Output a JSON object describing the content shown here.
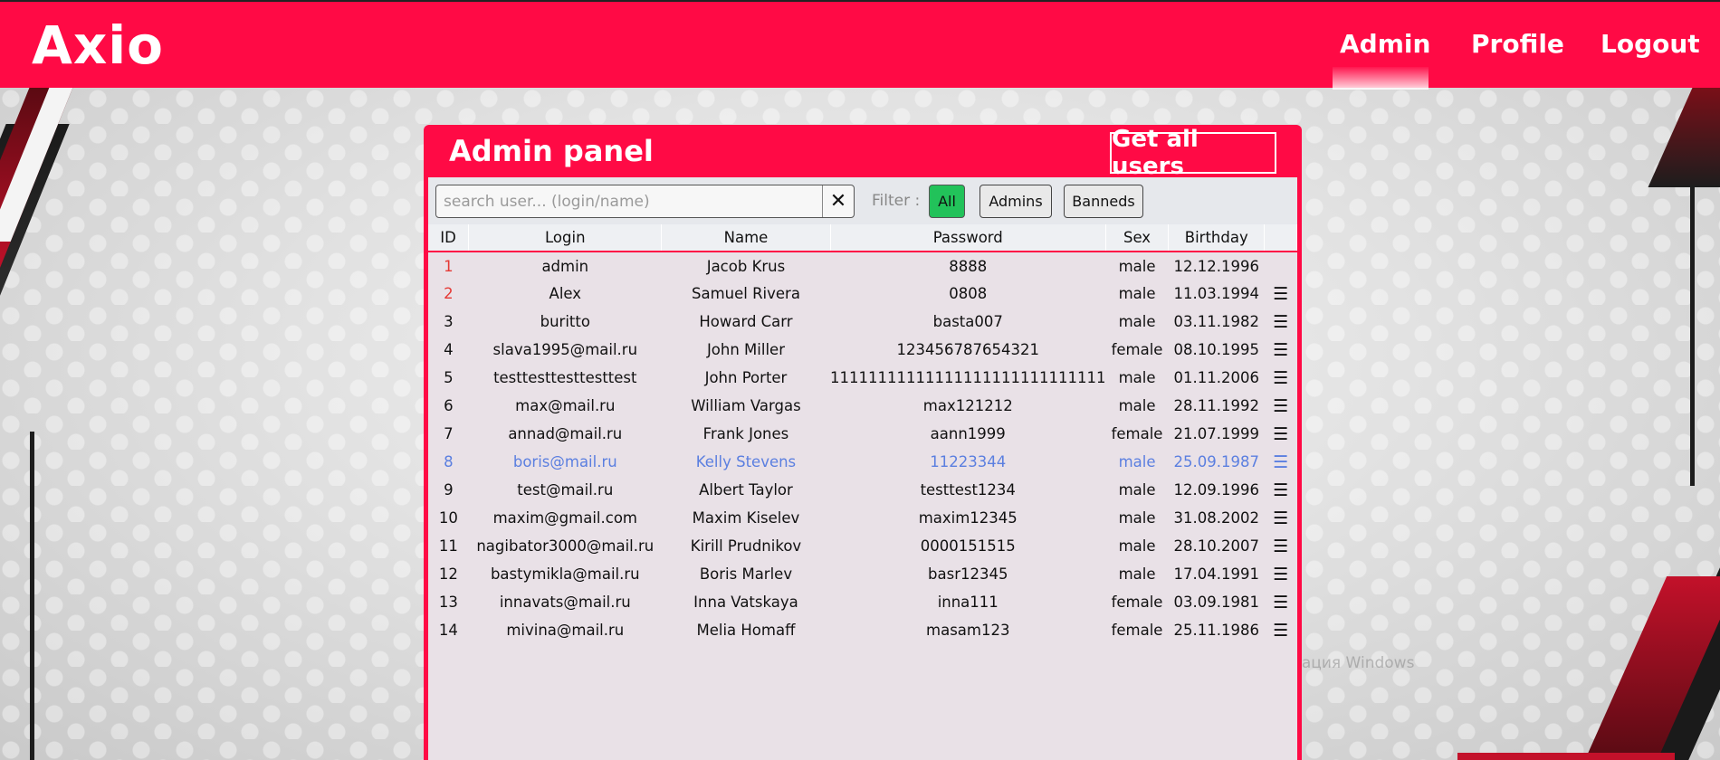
{
  "header": {
    "logo": "Axio",
    "nav": [
      {
        "label": "Admin",
        "active": true
      },
      {
        "label": "Profile",
        "active": false
      },
      {
        "label": "Logout",
        "active": false
      }
    ]
  },
  "panel": {
    "title": "Admin panel",
    "get_all_button": "Get all users",
    "search": {
      "placeholder": "search user... (login/name)",
      "value": "",
      "clear_icon": "✕"
    },
    "filter": {
      "label": "Filter :",
      "options": [
        "All",
        "Admins",
        "Banneds"
      ],
      "selected": "All"
    },
    "table": {
      "columns": [
        "ID",
        "Login",
        "Name",
        "Password",
        "Sex",
        "Birthday",
        ""
      ],
      "rows": [
        {
          "id": "1",
          "login": "admin",
          "name": "Jacob Krus",
          "password": "8888",
          "sex": "male",
          "birthday": "12.12.1996",
          "menu": ""
        },
        {
          "id": "2",
          "login": "Alex",
          "name": "Samuel Rivera",
          "password": "0808",
          "sex": "male",
          "birthday": "11.03.1994",
          "menu": "☰"
        },
        {
          "id": "3",
          "login": "buritto",
          "name": "Howard Carr",
          "password": "basta007",
          "sex": "male",
          "birthday": "03.11.1982",
          "menu": "☰"
        },
        {
          "id": "4",
          "login": "slava1995@mail.ru",
          "name": "John Miller",
          "password": "123456787654321",
          "sex": "female",
          "birthday": "08.10.1995",
          "menu": "☰"
        },
        {
          "id": "5",
          "login": "testtesttesttesttest",
          "name": "John Porter",
          "password": "11111111111111111111111111111",
          "sex": "male",
          "birthday": "01.11.2006",
          "menu": "☰"
        },
        {
          "id": "6",
          "login": "max@mail.ru",
          "name": "William Vargas",
          "password": "max121212",
          "sex": "male",
          "birthday": "28.11.1992",
          "menu": "☰"
        },
        {
          "id": "7",
          "login": "annad@mail.ru",
          "name": "Frank Jones",
          "password": "aann1999",
          "sex": "female",
          "birthday": "21.07.1999",
          "menu": "☰"
        },
        {
          "id": "8",
          "login": "boris@mail.ru",
          "name": "Kelly Stevens",
          "password": "11223344",
          "sex": "male",
          "birthday": "25.09.1987",
          "menu": "☰"
        },
        {
          "id": "9",
          "login": "test@mail.ru",
          "name": "Albert Taylor",
          "password": "testtest1234",
          "sex": "male",
          "birthday": "12.09.1996",
          "menu": "☰"
        },
        {
          "id": "10",
          "login": "maxim@gmail.com",
          "name": "Maxim Kiselev",
          "password": "maxim12345",
          "sex": "male",
          "birthday": "31.08.2002",
          "menu": "☰"
        },
        {
          "id": "11",
          "login": "nagibator3000@mail.ru",
          "name": "Kirill Prudnikov",
          "password": "0000151515",
          "sex": "male",
          "birthday": "28.10.2007",
          "menu": "☰"
        },
        {
          "id": "12",
          "login": "bastymikla@mail.ru",
          "name": "Boris Marlev",
          "password": "basr12345",
          "sex": "male",
          "birthday": "17.04.1991",
          "menu": "☰"
        },
        {
          "id": "13",
          "login": "innavats@mail.ru",
          "name": "Inna Vatskaya",
          "password": "inna111",
          "sex": "female",
          "birthday": "03.09.1981",
          "menu": "☰"
        },
        {
          "id": "14",
          "login": "mivina@mail.ru",
          "name": "Melia Homaff",
          "password": "masam123",
          "sex": "female",
          "birthday": "25.11.1986",
          "menu": "☰"
        }
      ]
    }
  },
  "watermark": "Активация Windows",
  "colors": {
    "brand": "#ff0a45",
    "filter_active": "#22c25a",
    "id_admin": "#e53935",
    "row_highlight": "#5b7fe0"
  }
}
